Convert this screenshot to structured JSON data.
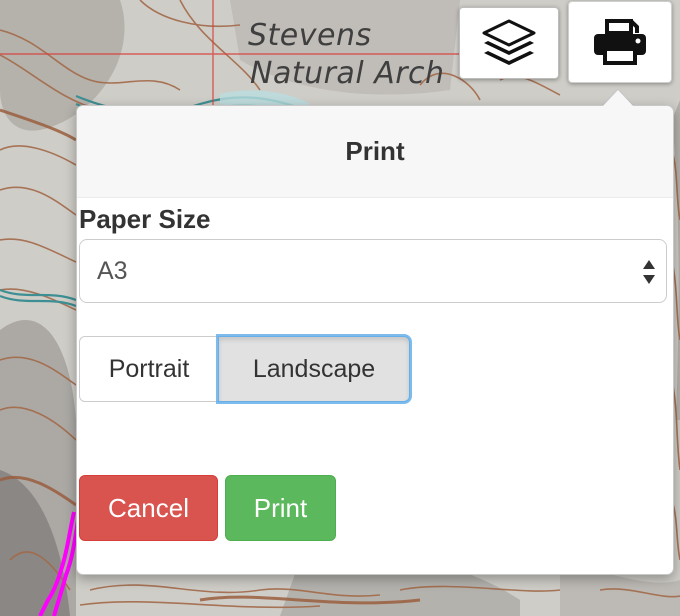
{
  "map": {
    "place_name_line1": "Stevens",
    "place_name_line2": "Natural Arch"
  },
  "controls": {
    "layers_icon": "layers-icon",
    "print_icon": "printer-icon"
  },
  "print_dialog": {
    "title": "Print",
    "paper_size_label": "Paper Size",
    "paper_size_value": "A3",
    "orientation_options": [
      "Portrait",
      "Landscape"
    ],
    "selected_orientation": "Landscape",
    "cancel_label": "Cancel",
    "print_label": "Print"
  },
  "colors": {
    "cancel": "#d9534f",
    "print": "#5cb85c",
    "focus_ring": "#66afe9",
    "trail": "#ff00ff"
  }
}
